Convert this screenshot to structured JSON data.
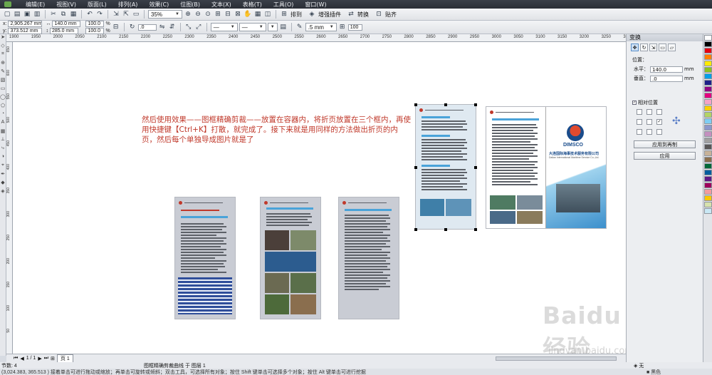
{
  "menu": [
    "编辑(E)",
    "视图(V)",
    "版面(L)",
    "排列(A)",
    "效果(C)",
    "位图(B)",
    "文本(X)",
    "表格(T)",
    "工具(O)",
    "窗口(W)"
  ],
  "toolbar": {
    "zoom": "35%",
    "arrange_label": "排到",
    "plugin_label": "增强插件",
    "convert_label": "转换",
    "paste_label": "贴齐"
  },
  "propbar": {
    "x": "2,905.267 mm",
    "y": "373.512 mm",
    "w": "140.0 mm",
    "h": "285.0 mm",
    "sx": "100.0",
    "sy": "100.0",
    "pct": "%",
    "rotation": ".0",
    "outline": ".5 mm",
    "scale100": "100"
  },
  "ruler_top": [
    "1900",
    "1950",
    "2000",
    "2050",
    "2100",
    "2150",
    "2200",
    "2250",
    "2300",
    "2350",
    "2400",
    "2450",
    "2500",
    "2550",
    "2600",
    "2650",
    "2700",
    "2750",
    "2800",
    "2850",
    "2900",
    "2950",
    "3000",
    "3050",
    "3100",
    "3150",
    "3200",
    "3250",
    "3300"
  ],
  "ruler_left": [
    "650",
    "600",
    "550",
    "500",
    "450",
    "400",
    "350",
    "300",
    "250",
    "200",
    "150",
    "100",
    "50"
  ],
  "annotation": "然后使用效果——图框精确剪裁——放置在容器内，将折页放置在三个框内，再使用快捷键【Ctrl+K】打散，就完成了。接下来就是用同样的方法做出折页的内页，然后每个单独导成图片就是了",
  "brochure": {
    "company_cn": "大连国际海事技术服务有限公司",
    "company_en": "Dalian International Maritime Service Co.,Ltd.",
    "brand": "DIMSCO"
  },
  "pagebar": {
    "page_info": "1 / 1",
    "page_tab": "页 1"
  },
  "status": {
    "objects": "节数: 4",
    "selection": "图框精确剪裁曲线 于 图层 1",
    "hint": "(3,024.383, 365.513 )  接着单击可进行拖动或缩放；再单击可旋转或倾斜；双击工具，可选择所有对象；按住 Shift 键单击可选择多个对象；按住 Alt 键单击可进行挖掘",
    "fill": "无",
    "outline": "黑色"
  },
  "docker": {
    "title": "变换",
    "position_label": "位置：",
    "h_label": "水平：",
    "h_value": "140.0",
    "v_label": "垂直：",
    "v_value": ".0",
    "unit": "mm",
    "relative_label": "相对位置",
    "apply_copy": "应用到再制",
    "apply": "应用"
  },
  "watermark": {
    "main": "Baidu经验",
    "sub": "jingyan.baidu.com"
  },
  "colors": {
    "annotation": "#c0392b",
    "accent_blue": "#4aa3d9"
  },
  "palette": [
    "#ffffff",
    "#000000",
    "#e60012",
    "#ff7f00",
    "#ffea00",
    "#8dc21f",
    "#00a0e9",
    "#1d2088",
    "#920783",
    "#e4007f",
    "#f5a3c7",
    "#fdd000",
    "#b3d465",
    "#7ecef4",
    "#8c97cb",
    "#c490bf",
    "#a0a0a0",
    "#595757",
    "#c7b299",
    "#8b6f4e",
    "#006837",
    "#005e9e",
    "#601986",
    "#9e005d",
    "#f29c9f",
    "#fcc800",
    "#d7e2ad",
    "#c9e8f5"
  ]
}
